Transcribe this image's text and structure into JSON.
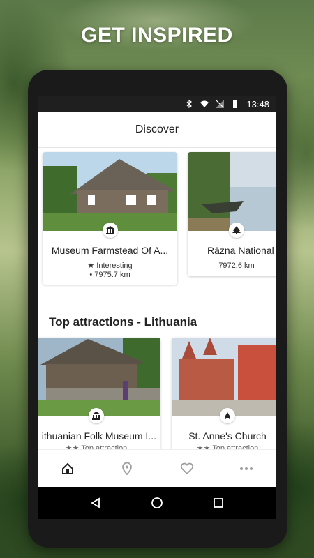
{
  "headline": "GET INSPIRED",
  "status": {
    "time": "13:48"
  },
  "appbar": {
    "title": "Discover"
  },
  "discover_cards": [
    {
      "title": "Museum Farmstead Of A...",
      "tag": "★ Interesting",
      "distance": "• 7975.7 km",
      "icon": "museum-icon"
    },
    {
      "title": "Rāzna National Park",
      "distance": "7972.6 km",
      "icon": "tree-icon"
    }
  ],
  "section": {
    "title": "Top attractions - Lithuania"
  },
  "top_cards": [
    {
      "title": "Lithuanian Folk Museum I...",
      "tag": "Top attraction",
      "icon": "museum-icon"
    },
    {
      "title": "St. Anne's Church",
      "tag": "Top attraction",
      "icon": "church-icon"
    }
  ],
  "nav": [
    "home-icon",
    "map-pin-icon",
    "heart-icon",
    "more-icon"
  ],
  "colors": {
    "accent": "#222222",
    "nav_inactive": "#9e9e9e"
  }
}
